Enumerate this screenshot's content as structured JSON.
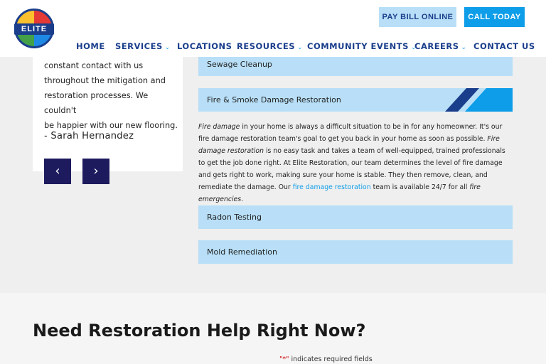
{
  "header": {
    "logo_text": "ELITE",
    "pay_bill_label": "PAY BILL ONLINE",
    "call_today_label": "CALL TODAY",
    "nav": [
      {
        "label": "HOME",
        "dropdown": false
      },
      {
        "label": "SERVICES",
        "dropdown": true
      },
      {
        "label": "LOCATIONS",
        "dropdown": false
      },
      {
        "label": "RESOURCES",
        "dropdown": true
      },
      {
        "label": "COMMUNITY EVENTS",
        "dropdown": true
      },
      {
        "label": "CAREERS",
        "dropdown": true
      },
      {
        "label": "CONTACT US",
        "dropdown": false
      }
    ],
    "colors": {
      "navy": "#1a3e8c",
      "accent": "#0e9de8",
      "light_blue": "#b8dff7"
    }
  },
  "testimonial": {
    "quote_lines": [
      "constant contact with us",
      "throughout the mitigation and",
      "restoration processes. We couldn't",
      "be happier with our new flooring."
    ],
    "author": "- Sarah Hernandez",
    "prev_icon": "chevron-left-icon",
    "next_icon": "chevron-right-icon"
  },
  "accordion": {
    "items": [
      {
        "label": "Sewage Cleanup",
        "expanded": false
      },
      {
        "label": "Fire & Smoke Damage Restoration",
        "expanded": true
      },
      {
        "label": "Radon Testing",
        "expanded": false
      },
      {
        "label": "Mold Remediation",
        "expanded": false
      }
    ],
    "body": {
      "p1_em": "Fire damage",
      "p1_text": " in your home is always a difficult situation to be in for any homeowner. It's our fire damage restoration team's goal to get you back in your home as soon as possible. ",
      "p2_em": "Fire damage restoration",
      "p2_text": " is no easy task and takes a team of well-equipped, trained professionals to get the job done right. At Elite Restoration, our team determines the level of fire damage and gets right to work, making sure your home is stable. They then remove, clean, and remediate the damage. Our ",
      "link_text": "fire damage restoration",
      "p3_text": " team is available 24/7 for all ",
      "p3_em": "fire emergencies",
      "p3_end": "."
    }
  },
  "cta": {
    "title": "Need Restoration Help Right Now?",
    "required_star": "\"*\"",
    "required_text": " indicates required fields"
  }
}
